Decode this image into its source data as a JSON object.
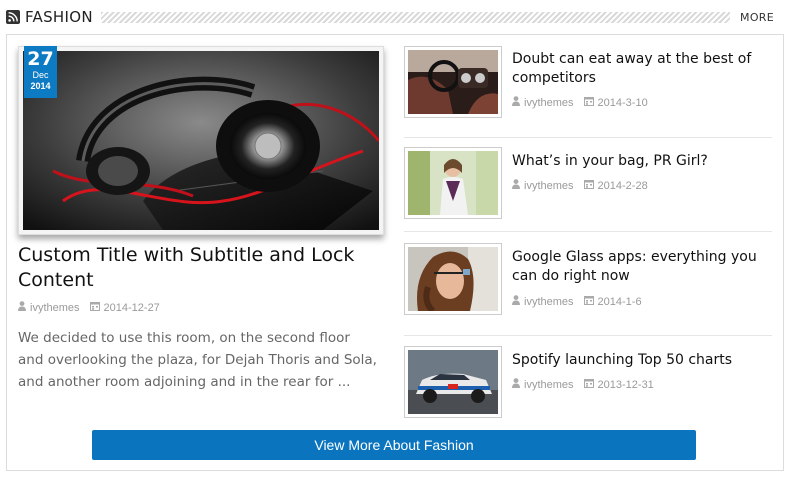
{
  "header": {
    "icon": "rss-icon",
    "title": "FASHION",
    "more_label": "MORE"
  },
  "featured": {
    "date": {
      "day": "27",
      "month": "Dec",
      "year": "2014"
    },
    "title": "Custom Title with Subtitle and Lock Content",
    "author": "ivythemes",
    "date_text": "2014-12-27",
    "excerpt": "We decided to use this room, on the second floor and overlooking the plaza, for Dejah Thoris and Sola, and another room adjoining and in the rear for ..."
  },
  "posts": [
    {
      "title": "Doubt can eat away at the best of competitors",
      "author": "ivythemes",
      "date": "2014-3-10"
    },
    {
      "title": "What’s in your bag, PR Girl?",
      "author": "ivythemes",
      "date": "2014-2-28"
    },
    {
      "title": "Google Glass apps: everything you can do right now",
      "author": "ivythemes",
      "date": "2014-1-6"
    },
    {
      "title": "Spotify launching Top 50 charts",
      "author": "ivythemes",
      "date": "2013-12-31"
    }
  ],
  "button": {
    "label": "View More About Fashion"
  },
  "colors": {
    "accent": "#0a74bf",
    "meta_text": "#9a9a9a",
    "excerpt_text": "#666666"
  },
  "icons": {
    "author": "user-icon",
    "date": "calendar-icon"
  }
}
